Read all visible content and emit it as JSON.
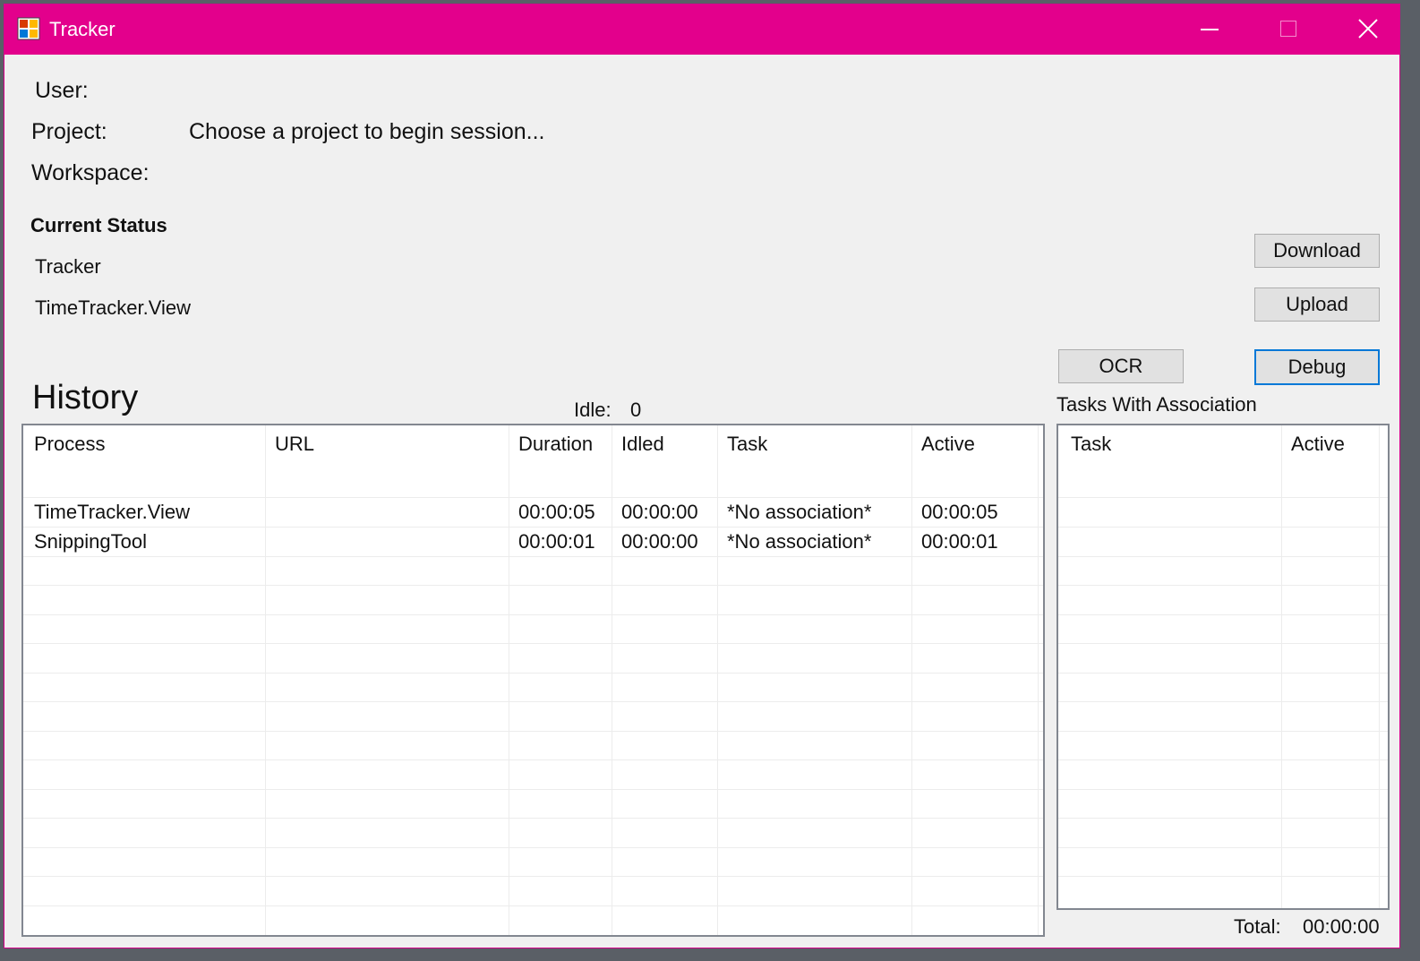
{
  "window": {
    "title": "Tracker"
  },
  "info": {
    "user_label": "User:",
    "project_label": "Project:",
    "project_value": "Choose a project to begin session...",
    "workspace_label": "Workspace:"
  },
  "status": {
    "heading": "Current Status",
    "line1": "Tracker",
    "line2": "TimeTracker.View"
  },
  "buttons": {
    "download": "Download",
    "upload": "Upload",
    "ocr": "OCR",
    "debug": "Debug"
  },
  "history": {
    "title": "History",
    "idle_label": "Idle:",
    "idle_value": "0",
    "columns": [
      "Process",
      "URL",
      "Duration",
      "Idled",
      "Task",
      "Active"
    ],
    "rows": [
      [
        "TimeTracker.View",
        "",
        "00:00:05",
        "00:00:00",
        "*No association*",
        "00:00:05"
      ],
      [
        "SnippingTool",
        "",
        "00:00:01",
        "00:00:00",
        "*No association*",
        "00:00:01"
      ]
    ]
  },
  "tasks": {
    "title": "Tasks With Association",
    "columns": [
      "Task",
      "Active"
    ],
    "total_label": "Total:",
    "total_value": "00:00:00"
  },
  "colors": {
    "titlebar": "#e3008c",
    "focus": "#0078d7"
  }
}
